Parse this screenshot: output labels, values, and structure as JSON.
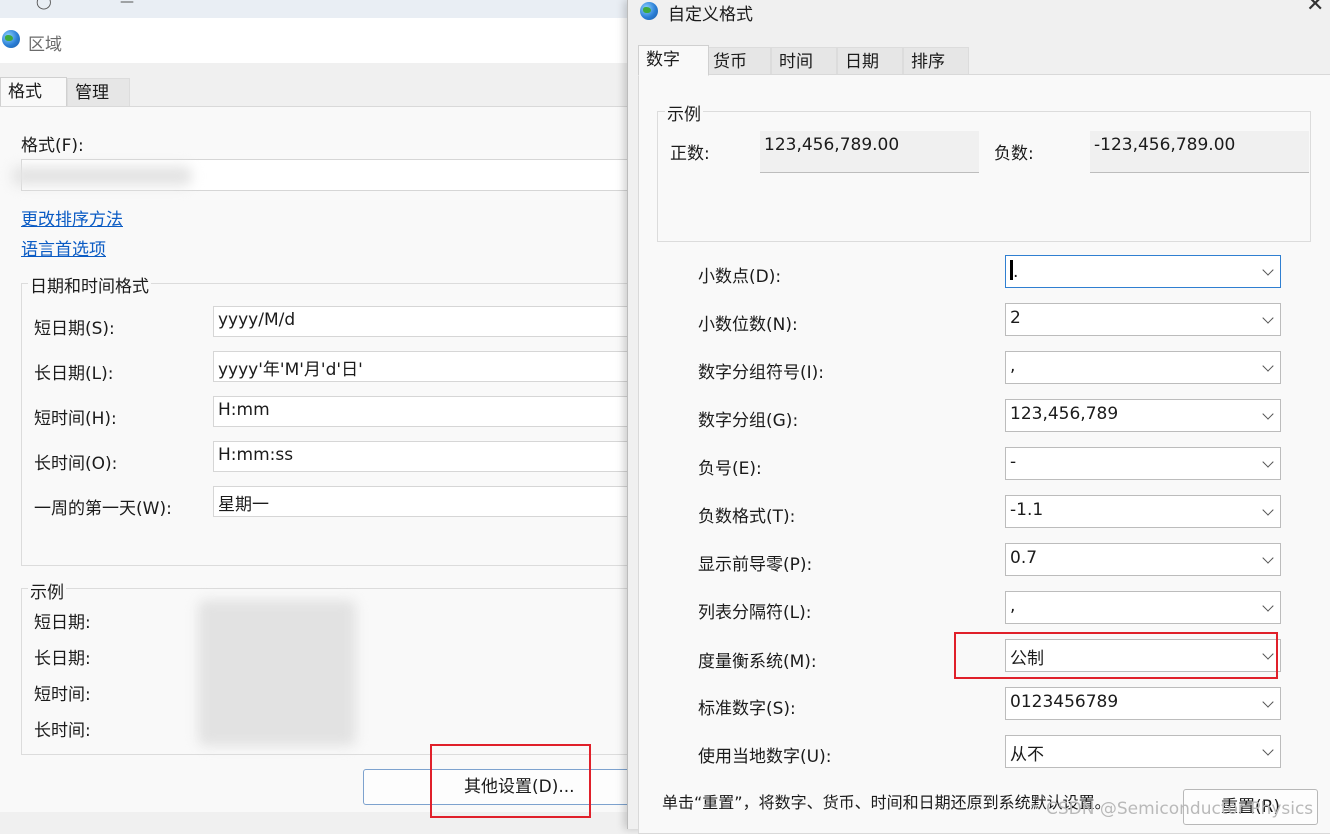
{
  "region": {
    "title": "区域",
    "tabs": [
      "格式",
      "管理"
    ],
    "format_label": "格式(F):",
    "links": [
      "更改排序方法",
      "语言首选项"
    ],
    "datetime_group": {
      "title": "日期和时间格式",
      "rows": [
        {
          "label": "短日期(S):",
          "value": "yyyy/M/d"
        },
        {
          "label": "长日期(L):",
          "value": "yyyy'年'M'月'd'日'"
        },
        {
          "label": "短时间(H):",
          "value": "H:mm"
        },
        {
          "label": "长时间(O):",
          "value": "H:mm:ss"
        },
        {
          "label": "一周的第一天(W):",
          "value": "星期一"
        }
      ]
    },
    "example_group": {
      "title": "示例",
      "rows": [
        "短日期:",
        "长日期:",
        "短时间:",
        "长时间:"
      ]
    },
    "other_settings_button": "其他设置(D)..."
  },
  "custom": {
    "title": "自定义格式",
    "close_glyph": "✕",
    "tabs": [
      "数字",
      "货币",
      "时间",
      "日期",
      "排序"
    ],
    "sample": {
      "title": "示例",
      "positive_label": "正数:",
      "positive_value": "123,456,789.00",
      "negative_label": "负数:",
      "negative_value": "-123,456,789.00"
    },
    "settings": [
      {
        "label": "小数点(D):",
        "value": "."
      },
      {
        "label": "小数位数(N):",
        "value": "2"
      },
      {
        "label": "数字分组符号(I):",
        "value": ","
      },
      {
        "label": "数字分组(G):",
        "value": "123,456,789"
      },
      {
        "label": "负号(E):",
        "value": "-"
      },
      {
        "label": "负数格式(T):",
        "value": "-1.1"
      },
      {
        "label": "显示前导零(P):",
        "value": "0.7"
      },
      {
        "label": "列表分隔符(L):",
        "value": ","
      },
      {
        "label": "度量衡系统(M):",
        "value": "公制"
      },
      {
        "label": "标准数字(S):",
        "value": "0123456789"
      },
      {
        "label": "使用当地数字(U):",
        "value": "从不"
      }
    ],
    "footer_note": "单击“重置”，将数字、货币、时间和日期还原到系统默认设置。",
    "reset_button": "重置(R)",
    "watermark": "CSDN @Semiconductor Physics"
  },
  "colors": {
    "highlight_red": "#e0202a",
    "link_blue": "#0a5bc4",
    "focus_blue": "#2f7fd1"
  },
  "icons": [
    "globe-icon",
    "chevron-down-icon",
    "close-icon"
  ]
}
